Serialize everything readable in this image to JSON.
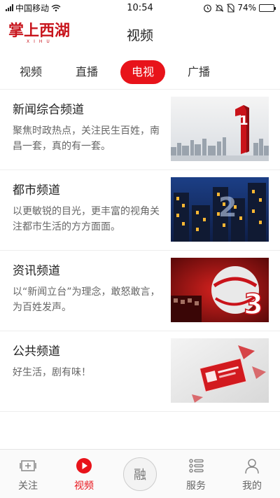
{
  "status_bar": {
    "carrier": "中国移动",
    "time": "10:54",
    "battery": "74%"
  },
  "header": {
    "logo_text": "掌上西湖",
    "logo_subtext": "XIHU",
    "title": "视频"
  },
  "tabs": [
    {
      "label": "视频",
      "active": false
    },
    {
      "label": "直播",
      "active": false
    },
    {
      "label": "电视",
      "active": true
    },
    {
      "label": "广播",
      "active": false
    }
  ],
  "channels": [
    {
      "title": "新闻综合频道",
      "description": "聚焦时政热点，关注民生百姓，南昌一套，真的有一套。",
      "thumb_text": "1"
    },
    {
      "title": "都市频道",
      "description": "以更敏锐的目光，更丰富的视角关注都市生活的方方面面。",
      "thumb_text": "2"
    },
    {
      "title": "资讯频道",
      "description": "以“新闻立台”为理念，敢怒敢言，为百姓发声。",
      "thumb_text": "3"
    },
    {
      "title": "公共频道",
      "description": "好生活，剧有味！",
      "thumb_text": ""
    }
  ],
  "bottom_nav": [
    {
      "label": "关注",
      "icon": "follow-icon",
      "active": false
    },
    {
      "label": "视频",
      "icon": "play-icon",
      "active": true
    },
    {
      "label": "融",
      "icon": "fusion-icon",
      "active": false
    },
    {
      "label": "服务",
      "icon": "service-icon",
      "active": false
    },
    {
      "label": "我的",
      "icon": "user-icon",
      "active": false
    }
  ],
  "colors": {
    "accent": "#e8131a",
    "logo": "#c8161e"
  }
}
